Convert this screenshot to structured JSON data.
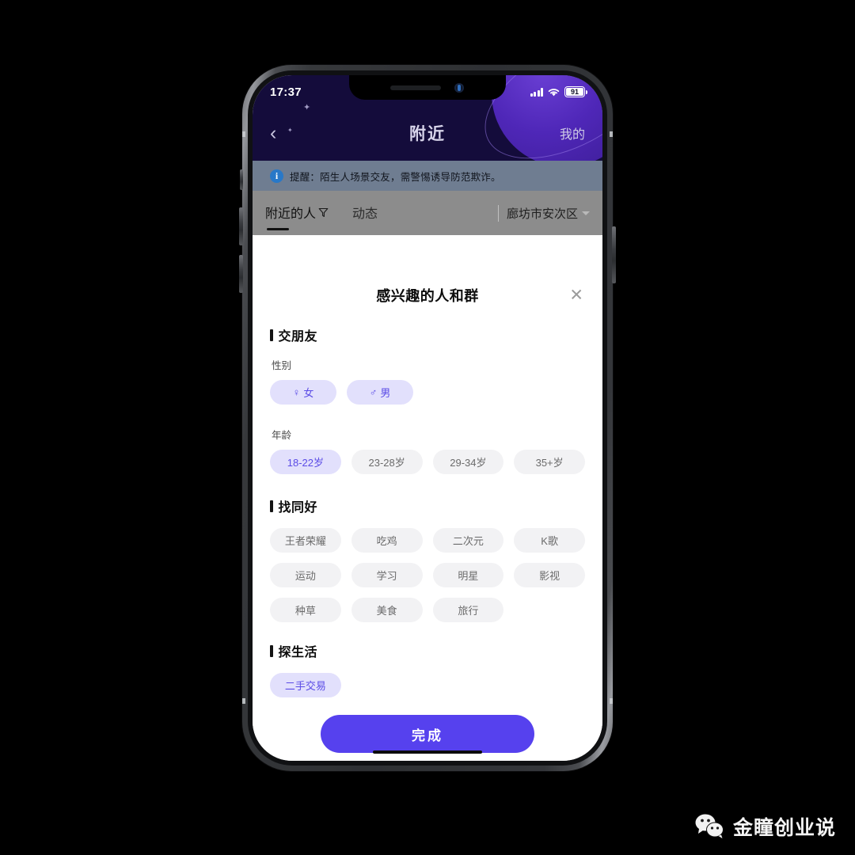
{
  "device": {
    "status_bar": {
      "time": "17:37",
      "battery_percent": "91",
      "signal_icon": "cellular-signal-icon",
      "wifi_icon": "wifi-icon"
    },
    "home_indicator": "home-indicator"
  },
  "app": {
    "nav": {
      "back_icon": "chevron-left-icon",
      "title": "附近",
      "mine_label": "我的"
    },
    "warning": {
      "icon": "info-icon",
      "text": "提醒：陌生人场景交友，需警惕诱导防范欺诈。"
    },
    "tabs": [
      {
        "label": "附近的人",
        "has_filter_icon": true,
        "active": true
      },
      {
        "label": "动态",
        "has_filter_icon": false,
        "active": false
      }
    ],
    "location": {
      "label": "廊坊市安次区",
      "caret_icon": "chevron-down-icon"
    }
  },
  "sheet": {
    "title": "感兴趣的人和群",
    "close_icon": "close-icon",
    "sections": [
      {
        "title": "交朋友",
        "fields": [
          {
            "label": "性别",
            "chips": [
              {
                "label": "女",
                "icon": "♀",
                "selected": true
              },
              {
                "label": "男",
                "icon": "♂",
                "selected": true
              }
            ]
          },
          {
            "label": "年龄",
            "chips": [
              {
                "label": "18-22岁",
                "selected": true
              },
              {
                "label": "23-28岁",
                "selected": false
              },
              {
                "label": "29-34岁",
                "selected": false
              },
              {
                "label": "35+岁",
                "selected": false
              }
            ]
          }
        ]
      },
      {
        "title": "找同好",
        "grid_chips": [
          {
            "label": "王者荣耀",
            "selected": false
          },
          {
            "label": "吃鸡",
            "selected": false
          },
          {
            "label": "二次元",
            "selected": false
          },
          {
            "label": "K歌",
            "selected": false
          },
          {
            "label": "运动",
            "selected": false
          },
          {
            "label": "学习",
            "selected": false
          },
          {
            "label": "明星",
            "selected": false
          },
          {
            "label": "影视",
            "selected": false
          },
          {
            "label": "种草",
            "selected": false
          },
          {
            "label": "美食",
            "selected": false
          },
          {
            "label": "旅行",
            "selected": false
          }
        ]
      },
      {
        "title": "探生活",
        "grid_chips": [
          {
            "label": "二手交易",
            "selected": true
          }
        ]
      }
    ],
    "done_label": "完成"
  },
  "watermark": {
    "logo_icon": "wechat-logo-icon",
    "text": "金瞳创业说"
  },
  "colors": {
    "accent": "#5641ee",
    "chip_selected_bg": "#e2e0fc",
    "chip_selected_text": "#5b4ce6",
    "chip_bg": "#f2f2f4",
    "header_bg": "#140c3b",
    "banner_bg": "#6f7d91",
    "tabstrip_bg": "#8c8c8c"
  }
}
